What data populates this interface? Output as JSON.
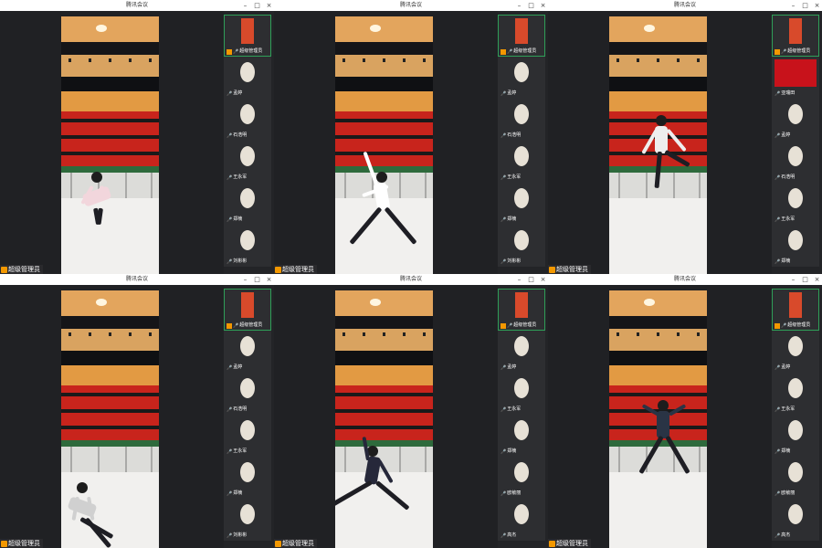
{
  "app_title": "腾讯会议",
  "window_controls": {
    "minimize": "–",
    "maximize": "□",
    "close": "×"
  },
  "presenter_label": "超级管理员",
  "windows": [
    {
      "sidebar": [
        {
          "name": "超级管理员",
          "kind": "room",
          "active": true
        },
        {
          "name": "孟婷",
          "kind": "avatar"
        },
        {
          "name": "石浩明",
          "kind": "avatar"
        },
        {
          "name": "王永军",
          "kind": "avatar"
        },
        {
          "name": "郑楠",
          "kind": "avatar"
        },
        {
          "name": "刘彬彬",
          "kind": "avatar"
        }
      ]
    },
    {
      "sidebar": [
        {
          "name": "超级管理员",
          "kind": "room",
          "active": true
        },
        {
          "name": "孟婷",
          "kind": "avatar"
        },
        {
          "name": "石浩明",
          "kind": "avatar"
        },
        {
          "name": "王永军",
          "kind": "avatar"
        },
        {
          "name": "郑楠",
          "kind": "avatar"
        },
        {
          "name": "刘彬彬",
          "kind": "avatar"
        }
      ]
    },
    {
      "sidebar": [
        {
          "name": "超级管理员",
          "kind": "room",
          "active": true
        },
        {
          "name": "亚瑞田",
          "kind": "banner"
        },
        {
          "name": "孟婷",
          "kind": "avatar"
        },
        {
          "name": "石浩明",
          "kind": "avatar"
        },
        {
          "name": "王永军",
          "kind": "avatar"
        },
        {
          "name": "郑楠",
          "kind": "avatar"
        }
      ]
    },
    {
      "sidebar": [
        {
          "name": "超级管理员",
          "kind": "room",
          "active": true
        },
        {
          "name": "孟婷",
          "kind": "avatar"
        },
        {
          "name": "石浩明",
          "kind": "avatar"
        },
        {
          "name": "王永军",
          "kind": "avatar"
        },
        {
          "name": "郑楠",
          "kind": "avatar"
        },
        {
          "name": "刘彬彬",
          "kind": "avatar"
        }
      ]
    },
    {
      "sidebar": [
        {
          "name": "超级管理员",
          "kind": "room",
          "active": true
        },
        {
          "name": "孟婷",
          "kind": "avatar"
        },
        {
          "name": "王永军",
          "kind": "avatar"
        },
        {
          "name": "郑楠",
          "kind": "avatar"
        },
        {
          "name": "欧敏丽",
          "kind": "avatar"
        },
        {
          "name": "高杰",
          "kind": "avatar"
        }
      ]
    },
    {
      "sidebar": [
        {
          "name": "超级管理员",
          "kind": "room",
          "active": true
        },
        {
          "name": "孟婷",
          "kind": "avatar"
        },
        {
          "name": "王永军",
          "kind": "avatar"
        },
        {
          "name": "郑楠",
          "kind": "avatar"
        },
        {
          "name": "欧敏丽",
          "kind": "avatar"
        },
        {
          "name": "高杰",
          "kind": "avatar"
        }
      ]
    }
  ],
  "colors": {
    "accent": "#f39800",
    "active_border": "#2f9f58",
    "wall_red": "#c8241c"
  }
}
